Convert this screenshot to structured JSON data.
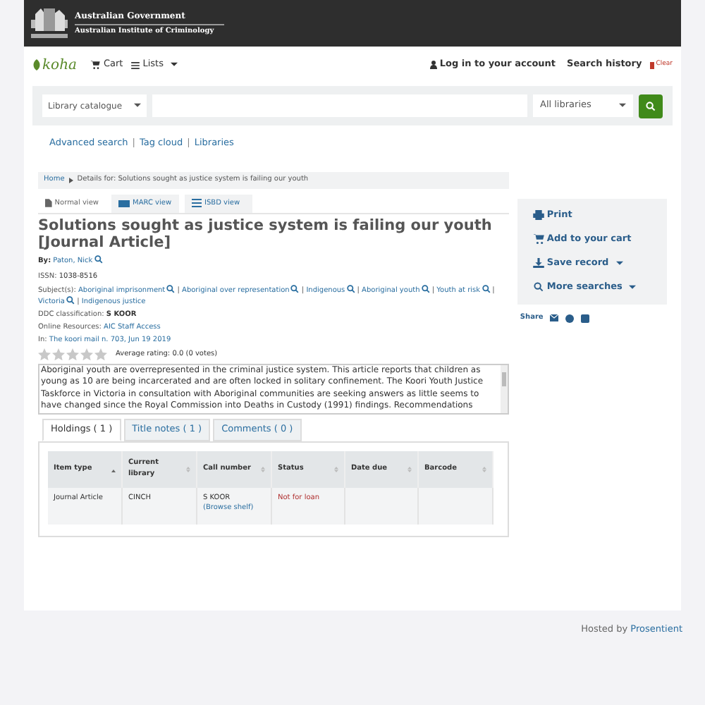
{
  "header": {
    "line_1": "Australian Government",
    "line_2": "Australian Institute of Criminology"
  },
  "navbar": {
    "logo": "koha",
    "cart": "Cart",
    "lists": "Lists",
    "login": "Log in to your account",
    "search_history": "Search history",
    "clear": "Clear"
  },
  "search": {
    "scope": "Library catalogue",
    "libraries": "All libraries"
  },
  "links": {
    "items": [
      "Advanced search",
      "Tag cloud",
      "Libraries"
    ],
    "separator": "|"
  },
  "breadcrumb": [
    "Home",
    "Details for: Solutions sought as justice system is failing our youth"
  ],
  "view_tabs": [
    {
      "label": "Normal view",
      "selected": true
    },
    {
      "label": "MARC view",
      "selected": false
    },
    {
      "label": "ISBD view",
      "selected": false
    }
  ],
  "record": {
    "title": "Solutions sought as justice system is failing our youth [Journal Article]",
    "by_label": "By:",
    "author": "Paton, Nick",
    "issn_label": "ISSN:",
    "issn": "1038-8516",
    "subjects_label": "Subject(s):",
    "subject_separator": "|",
    "subjects": [
      {
        "label": "Aboriginal imprisonment",
        "search": true
      },
      {
        "label": "Aboriginal over representation",
        "search": true
      },
      {
        "label": "Indigenous",
        "search": true
      },
      {
        "label": "Aboriginal youth",
        "search": true
      },
      {
        "label": "Youth at risk",
        "search": true
      },
      {
        "label": "Victoria",
        "search": true
      },
      {
        "label": "Indigenous justice",
        "search": false
      }
    ],
    "ddc_label": "DDC classification:",
    "ddc": "S KOOR",
    "online_label": "Online Resources:",
    "online": "AIC Staff Access",
    "in_label": "In:",
    "in": "The koori mail n. 703, Jun 19 2019",
    "stars": 0,
    "rating": "Average rating: 0.0 (0 votes)",
    "abstract": "Aboriginal youth are overrepresented in the criminal justice system. This article reports that children as young as 10 are being incarcerated and are often locked in solitary confinement. The Koori Youth Justice Taskforce in Victoria in consultation with Aboriginal communities are seeking answers as little seems to have changed since the Royal Commission into Deaths in Custody (1991) findings. Recommendations"
  },
  "tabs": [
    {
      "label": "Holdings ( 1 )",
      "selected": true
    },
    {
      "label": "Title notes ( 1 )",
      "selected": false
    },
    {
      "label": "Comments ( 0 )",
      "selected": false
    }
  ],
  "table": {
    "columns": [
      "Item type",
      "Current library",
      "Call number",
      "Status",
      "Date due",
      "Barcode"
    ],
    "rows": [
      {
        "item_type": "Journal Article",
        "library": "CINCH",
        "call_number": "S KOOR",
        "browse": "(Browse shelf)",
        "status": "Not for loan"
      }
    ]
  },
  "actions": [
    {
      "label": "Print",
      "dropdown": false
    },
    {
      "label": "Add to your cart",
      "dropdown": false
    },
    {
      "label": "Save record",
      "dropdown": true
    },
    {
      "label": "More searches",
      "dropdown": true
    }
  ],
  "share": {
    "label": "Share"
  },
  "footer": {
    "hosted": "Hosted by",
    "host": "Prosentient"
  }
}
